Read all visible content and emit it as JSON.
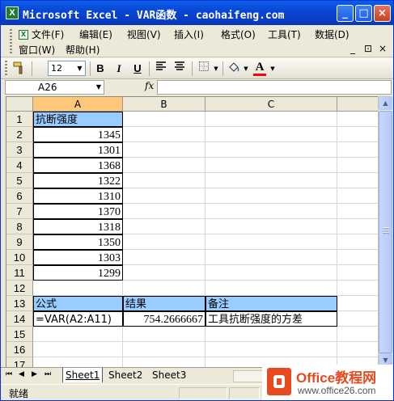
{
  "window": {
    "title": "Microsoft Excel - VAR函数 - caohaifeng.com",
    "app_icon": "X",
    "minimize_glyph": "_",
    "maximize_glyph": "□",
    "close_glyph": "×"
  },
  "menu": {
    "row1": [
      "文件(F)",
      "编辑(E)",
      "视图(V)",
      "插入(I)",
      "格式(O)",
      "工具(T)",
      "数据(D)"
    ],
    "row2": [
      "窗口(W)",
      "帮助(H)"
    ],
    "doc_controls": [
      "_",
      "⊡",
      "×"
    ]
  },
  "toolbar": {
    "font_size": "12",
    "bold": "B",
    "italic": "I",
    "underline": "U",
    "font_color_letter": "A",
    "font_color": "#ff0000"
  },
  "formula_bar": {
    "name_box": "A26",
    "fx_label": "fx",
    "formula": ""
  },
  "sheet": {
    "columns": [
      "A",
      "B",
      "C"
    ],
    "rows": [
      "1",
      "2",
      "3",
      "4",
      "5",
      "6",
      "7",
      "8",
      "9",
      "10",
      "11",
      "12",
      "13",
      "14",
      "15",
      "16",
      "17"
    ],
    "a1_header": "抗断强度",
    "values": [
      "1345",
      "1301",
      "1368",
      "1322",
      "1310",
      "1370",
      "1318",
      "1350",
      "1303",
      "1299"
    ],
    "row13": [
      "公式",
      "结果",
      "备注"
    ],
    "row14": [
      "=VAR(A2:A11)",
      "754.2666667",
      "工具抗断强度的方差"
    ]
  },
  "tabs": {
    "nav": [
      "⏮",
      "◀",
      "▶",
      "⏭"
    ],
    "sheets": [
      "Sheet1",
      "Sheet2",
      "Sheet3"
    ]
  },
  "status": {
    "text": "就绪"
  },
  "watermark": {
    "title": "Office教程网",
    "url": "www.office26.com"
  },
  "colors": {
    "header_fill": "#99ccff",
    "selected_header": "#ffc77a",
    "titlebar": "#0a5ee8"
  }
}
